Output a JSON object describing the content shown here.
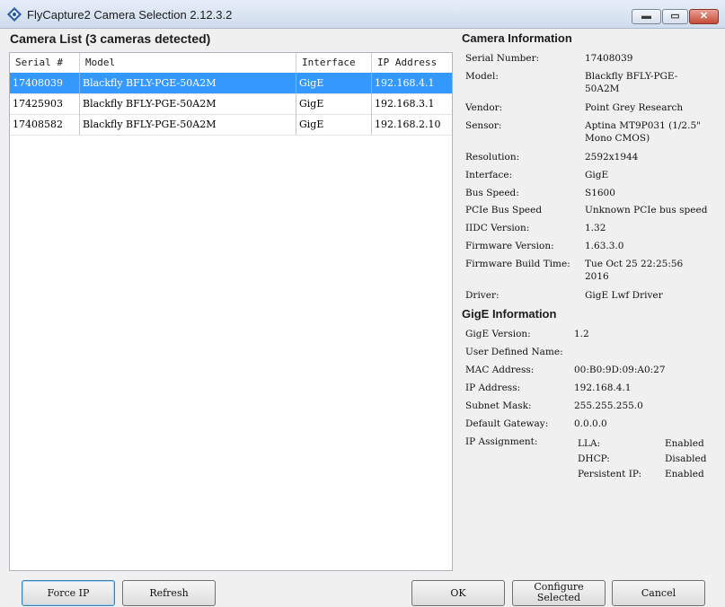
{
  "window": {
    "title": "FlyCapture2 Camera Selection 2.12.3.2",
    "controls": {
      "minimize": "▬",
      "maximize": "▭",
      "close": "✕"
    }
  },
  "camera_list": {
    "title": "Camera List (3 cameras detected)",
    "columns": [
      "Serial #",
      "Model",
      "Interface",
      "IP Address"
    ],
    "rows": [
      {
        "serial": "17408039",
        "model": "Blackfly BFLY-PGE-50A2M",
        "interface": "GigE",
        "ip": "192.168.4.1",
        "selected": true
      },
      {
        "serial": "17425903",
        "model": "Blackfly BFLY-PGE-50A2M",
        "interface": "GigE",
        "ip": "192.168.3.1",
        "selected": false
      },
      {
        "serial": "17408582",
        "model": "Blackfly BFLY-PGE-50A2M",
        "interface": "GigE",
        "ip": "192.168.2.10",
        "selected": false
      }
    ]
  },
  "camera_info": {
    "title": "Camera Information",
    "fields": [
      {
        "label": "Serial Number:",
        "value": "17408039"
      },
      {
        "label": "Model:",
        "value": "Blackfly BFLY-PGE-\n50A2M"
      },
      {
        "label": "Vendor:",
        "value": "Point Grey Research"
      },
      {
        "label": "Sensor:",
        "value": "Aptina MT9P031 (1/2.5\"\nMono CMOS)"
      },
      {
        "label": "Resolution:",
        "value": "2592x1944"
      },
      {
        "label": "Interface:",
        "value": "GigE"
      },
      {
        "label": "Bus Speed:",
        "value": "S1600"
      },
      {
        "label": "PCIe Bus Speed",
        "value": "Unknown PCIe bus speed"
      },
      {
        "label": "IIDC Version:",
        "value": "1.32"
      },
      {
        "label": "Firmware Version:",
        "value": "1.63.3.0"
      },
      {
        "label": "Firmware Build Time:",
        "value": "Tue Oct 25 22:25:56\n2016"
      },
      {
        "label": "Driver:",
        "value": "GigE Lwf Driver"
      }
    ]
  },
  "gige_info": {
    "title": "GigE Information",
    "fields": [
      {
        "label": "GigE Version:",
        "value": "1.2"
      },
      {
        "label": "User Defined Name:",
        "value": ""
      },
      {
        "label": "MAC Address:",
        "value": "00:B0:9D:09:A0:27"
      },
      {
        "label": "IP Address:",
        "value": "192.168.4.1"
      },
      {
        "label": "Subnet Mask:",
        "value": "255.255.255.0"
      },
      {
        "label": "Default Gateway:",
        "value": "0.0.0.0"
      },
      {
        "label": "IP Assignment:",
        "value": ""
      }
    ],
    "ip_assignment": [
      {
        "mode": "LLA:",
        "state": "Enabled"
      },
      {
        "mode": "DHCP:",
        "state": "Disabled"
      },
      {
        "mode": "Persistent IP:",
        "state": "Enabled"
      }
    ]
  },
  "buttons": {
    "force_ip": "Force IP",
    "refresh": "Refresh",
    "ok": "OK",
    "configure_line1": "Configure",
    "configure_line2": "Selected",
    "cancel": "Cancel"
  },
  "colors": {
    "selection": "#3399ff",
    "background": "#f0f0f0"
  }
}
